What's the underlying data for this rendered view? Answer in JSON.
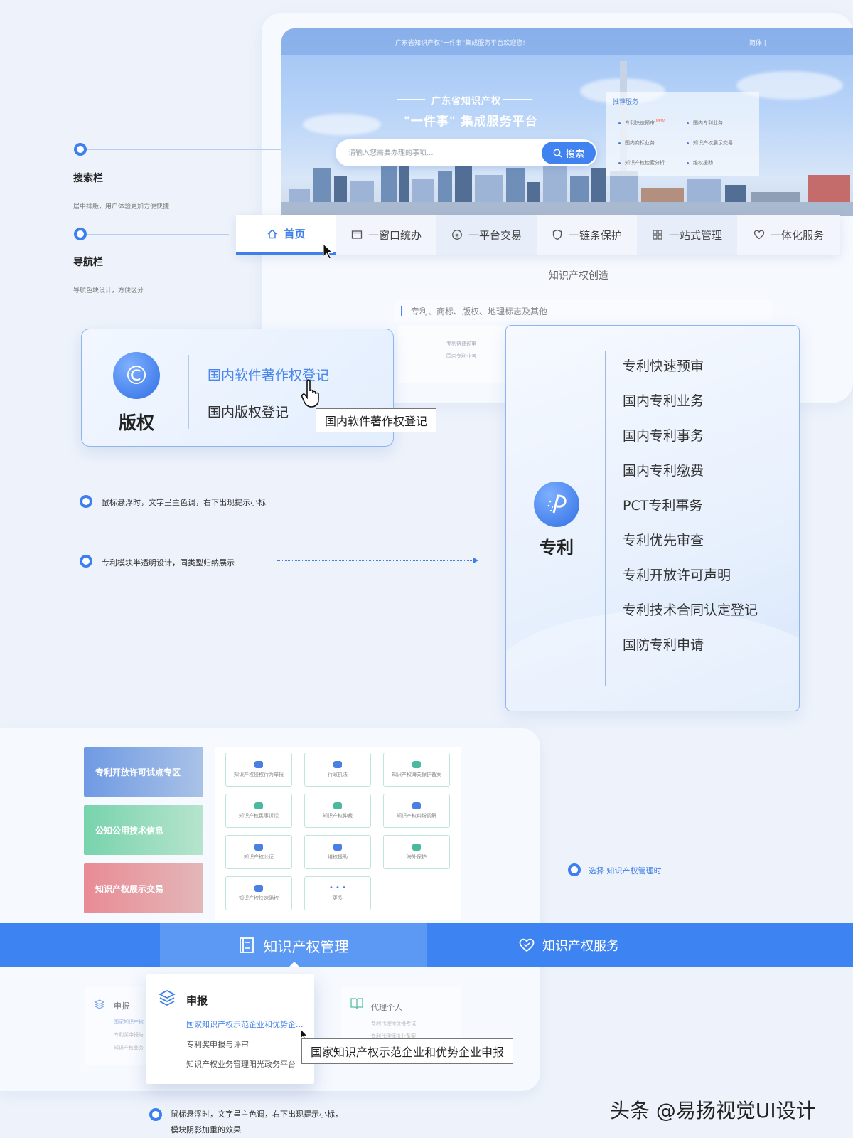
{
  "hero": {
    "topbar_text": "广东省知识产权\"一件事\"集成服务平台欢迎您!",
    "topbar_lang": "| 简体 |",
    "subtitle": "广东省知识产权",
    "title": "\"一件事\" 集成服务平台",
    "search_placeholder": "请输入您需要办理的事项...",
    "search_button": "搜索",
    "recommend": {
      "title": "推荐服务",
      "new_badge": "NEW",
      "items": [
        "专利快速预审",
        "国内专利业务",
        "国内商标业务",
        "知识产权展示交易",
        "知识产权检索分析",
        "维权援助"
      ]
    }
  },
  "nav": {
    "items": [
      "首页",
      "一窗口统办",
      "一平台交易",
      "一链条保护",
      "一站式管理",
      "一体化服务"
    ]
  },
  "section": {
    "title": "知识产权创造",
    "filter": "专利、商标、版权、地理标志及其他",
    "ghost_lines": [
      "专利快速预审",
      "国内专利业务"
    ]
  },
  "annotations": {
    "search_title": "搜索栏",
    "search_desc": "居中排版，用户体验更加方便快捷",
    "nav_title": "导航栏",
    "nav_desc": "导航色块设计，方便区分",
    "hover_note": "鼠标悬浮时，文字呈主色调，右下出现提示小标",
    "patent_note": "专利模块半透明设计，同类型归纳展示",
    "select_note": "选择 知识产权管理时",
    "bottom_note_1": "鼠标悬浮时，文字呈主色调，右下出现提示小标，",
    "bottom_note_2": "模块阴影加重的效果"
  },
  "copyright": {
    "name": "版权",
    "links": [
      "国内软件著作权登记",
      "国内版权登记"
    ],
    "tooltip": "国内软件著作权登记"
  },
  "patent": {
    "name": "专利",
    "items": [
      "专利快速预审",
      "国内专利业务",
      "国内专利事务",
      "国内专利缴费",
      "PCT专利事务",
      "专利优先审查",
      "专利开放许可声明",
      "专利技术合同认定登记",
      "国防专利申请"
    ]
  },
  "management": {
    "promos": [
      "专利开放许可试点专区",
      "公知公用技术信息",
      "知识产权展示交易"
    ],
    "tiles": [
      "知识产权侵权行为举报",
      "行政执法",
      "知识产权海关保护备案",
      "知识产权民事诉讼",
      "知识产权仲裁",
      "知识产权纠纷调解",
      "知识产权公证",
      "维权援助",
      "海外保护",
      "知识产权快速确权",
      "更多"
    ],
    "tabs": [
      "知识产权管理",
      "知识产权服务"
    ],
    "ghost_left": {
      "title": "申报",
      "lines": [
        "国家知识产权",
        "专利奖申报与",
        "知识产权业务"
      ]
    },
    "ghost_right": {
      "title": "代理个人",
      "lines": [
        "专利代理师资格考试",
        "专利代理师执业备案"
      ]
    },
    "popup": {
      "title": "申报",
      "links": [
        "国家知识产权示范企业和优势企...",
        "专利奖申报与评审",
        "知识产权业务管理阳光政务平台"
      ]
    },
    "tooltip": "国家知识产权示范企业和优势企业申报"
  },
  "watermark": "头条 @易扬视觉UI设计",
  "colors": {
    "primary": "#3e7fe8",
    "tab_bar": "#3d83f2",
    "tab_active": "#5c99f5"
  }
}
